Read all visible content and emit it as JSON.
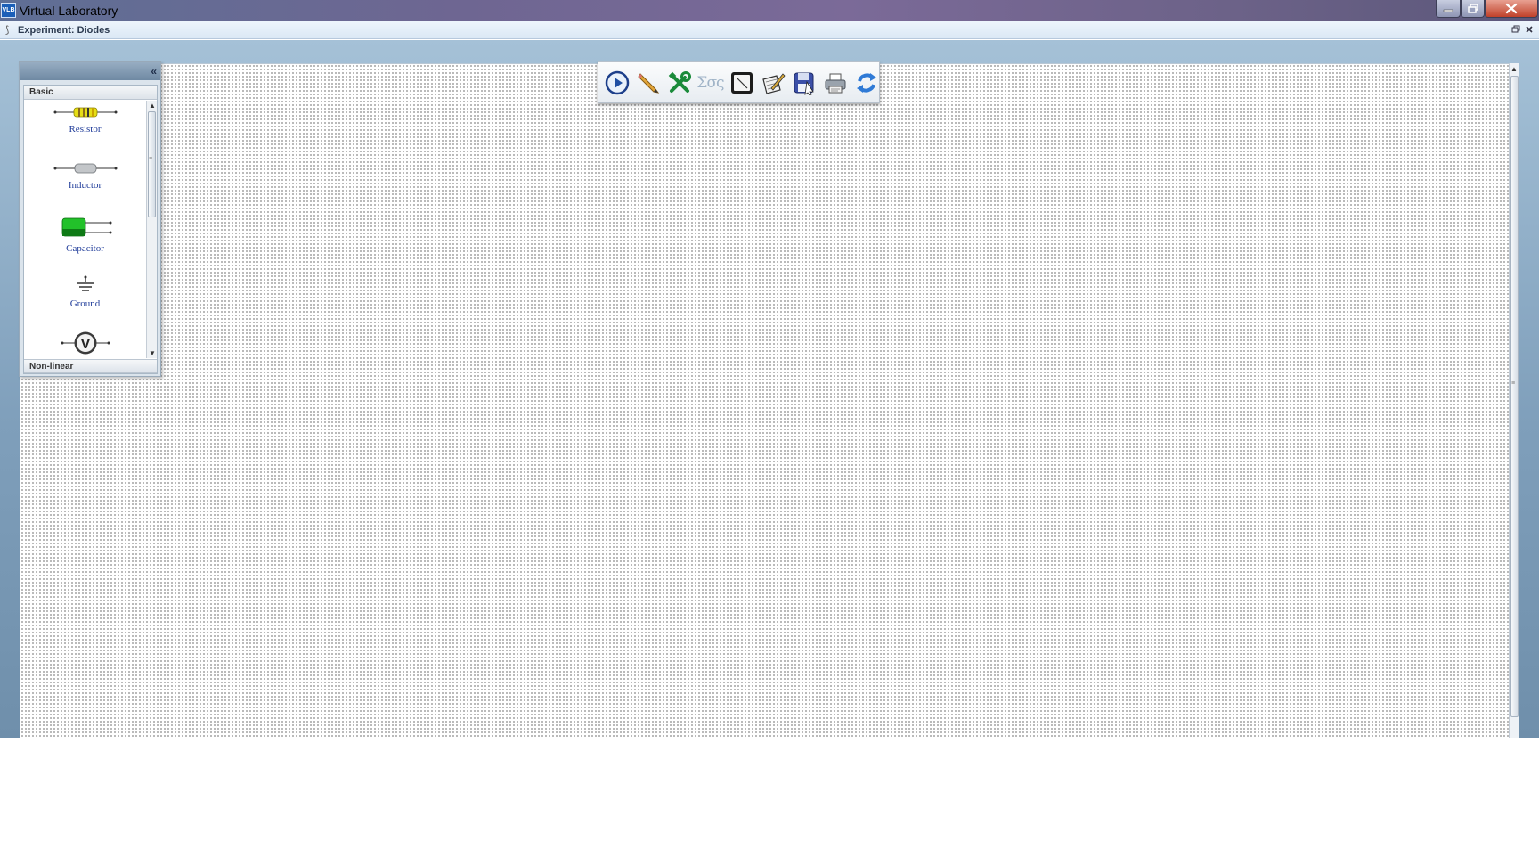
{
  "window": {
    "title": "Virtual Laboratory",
    "icon_text": "VLB",
    "icon": "vlab-app-icon",
    "controls": [
      "minimize-icon",
      "maximize-icon",
      "close-icon"
    ]
  },
  "experiment": {
    "title": "Experiment: Diodes",
    "controls": [
      "restore-icon",
      "close-icon"
    ]
  },
  "toolbar": {
    "tools": [
      {
        "name": "run-button",
        "icon": "play-icon"
      },
      {
        "name": "wire-tool-button",
        "icon": "pencil-icon"
      },
      {
        "name": "tools-button",
        "icon": "wrench-screwdriver-icon"
      },
      {
        "name": "equations-button",
        "icon": "sigma-icon",
        "text": "Σσς"
      },
      {
        "name": "oscilloscope-button",
        "icon": "oscilloscope-icon"
      },
      {
        "name": "notes-button",
        "icon": "notepad-icon"
      },
      {
        "name": "save-button",
        "icon": "save-icon"
      },
      {
        "name": "print-button",
        "icon": "printer-icon"
      },
      {
        "name": "refresh-button",
        "icon": "refresh-icon"
      }
    ]
  },
  "palette": {
    "collapse_icon": "double-chevron-left-icon",
    "sections": {
      "basic": "Basic",
      "nonlinear": "Non-linear"
    },
    "components": [
      {
        "label": "Resistor",
        "icon": "resistor-icon"
      },
      {
        "label": "Inductor",
        "icon": "inductor-icon"
      },
      {
        "label": "Capacitor",
        "icon": "capacitor-icon"
      },
      {
        "label": "Ground",
        "icon": "ground-icon"
      },
      {
        "label": "",
        "icon": "voltmeter-icon",
        "symbol": "V"
      }
    ]
  },
  "colors": {
    "canvas_bg": "#ffffff",
    "workspace_bg": "#8faac3",
    "label_blue": "#213d9a",
    "capacitor_green": "#22c12a",
    "resistor_yellow": "#e6de16"
  }
}
